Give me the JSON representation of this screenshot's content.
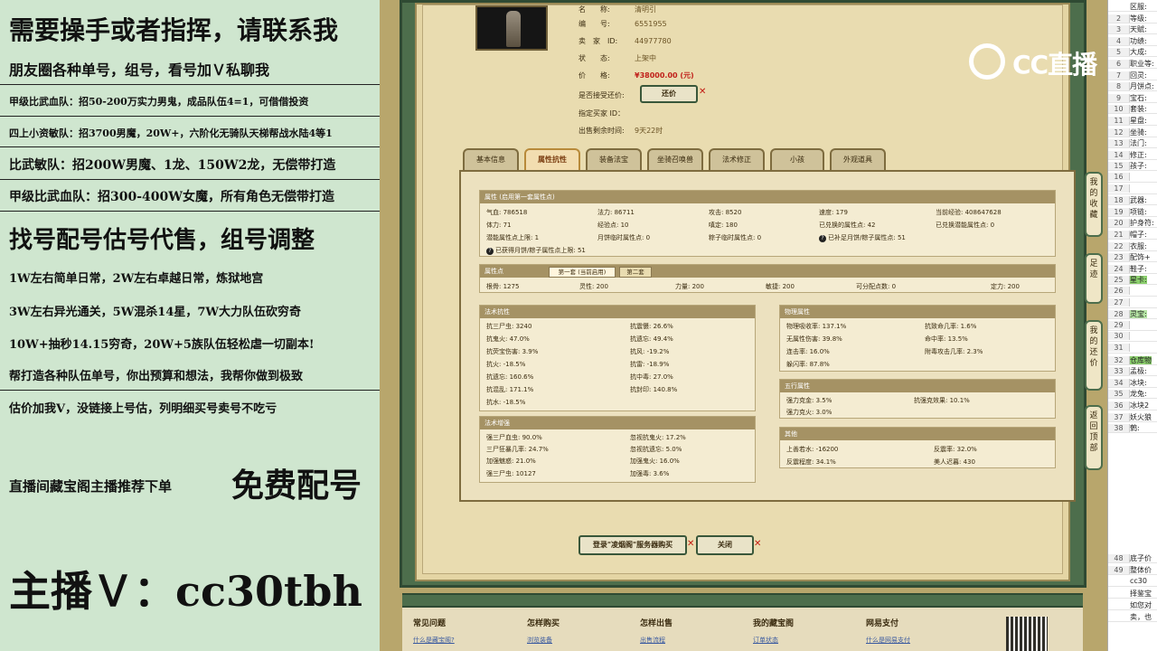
{
  "left_panel": {
    "lines": [
      "需要操手或者指挥，请联系我",
      "朋友圈各种单号，组号，看号加Ｖ私聊我",
      "甲级比武血队：招50-200万实力男鬼，成品队伍4=1，可借借投资",
      "四上小资敏队：招3700男魔，20W+，六阶化无骑队天梯帮战水陆4等1",
      "比武敏队：招200W男魔、1龙、150W2龙，无偿带打造",
      "甲级比武血队：招300-400W女魔，所有角色无偿带打造",
      "找号配号估号代售，组号调整",
      "1W左右简单日常，2W左右卓越日常，炼狱地宫",
      "3W左右异光通关，5W混杀14星，7W大力队伍砍穷奇",
      "10W+抽秒14.15穷奇，20W+5族队伍轻松虐一切副本!",
      "帮打造各种队伍单号，你出预算和想法，我帮你做到极致",
      "估价加我V，没链接上号估，列明细买号卖号不吃亏",
      "直播间藏宝阁主播推荐下单",
      "免费配号",
      "主播Ｖ：cc30tbh"
    ]
  },
  "item_info": {
    "rows": [
      {
        "k": "名　　称:",
        "v": "清明引"
      },
      {
        "k": "编　　号:",
        "v": "6551955"
      },
      {
        "k": "卖　家　ID:",
        "v": "44977780"
      },
      {
        "k": "状　　态:",
        "v": "上架中"
      },
      {
        "k": "价　　格:",
        "v": "¥38000.00 (元)"
      },
      {
        "k": "是否接受还价:",
        "v": ""
      },
      {
        "k": "指定买家 ID：",
        "v": ""
      },
      {
        "k": "出售剩余时间:",
        "v": "9天22时"
      }
    ],
    "offer_button": "还价"
  },
  "tabs": [
    "基本信息",
    "属性抗性",
    "装备法宝",
    "坐骑召唤兽",
    "法术修正",
    "小孩",
    "外观道具"
  ],
  "attr_section": {
    "header": "属性 (启用第一套属性点)",
    "cells": [
      "气血: 786518",
      "法力: 86711",
      "攻击: 8520",
      "速度: 179",
      "当前经验: 408647628",
      "体力: 71",
      "经验点: 10",
      "嗔定: 180",
      "已兑换的属性点: 42",
      "已兑换潜能属性点: 0",
      "潜能属性点上限: 1",
      "月饼临时属性点: 0",
      "粽子临时属性点: 0",
      "已补足月饼/粽子属性点: 51",
      "已获得月饼/粽子属性点上限: 51"
    ]
  },
  "attr_points": {
    "header": "属性点",
    "subtabs": [
      "第一套 (当前启用)",
      "第二套"
    ],
    "cells": [
      "根骨: 1275",
      "灵性: 200",
      "力量: 200",
      "敏捷: 200",
      "可分配点数: 0",
      "定力: 200"
    ]
  },
  "magic_resist": {
    "header": "法术抗性",
    "cells": [
      "抗三尸虫: 3240",
      "抗震慑: 26.6%",
      "抗鬼火: 47.0%",
      "抗遗忘: 49.4%",
      "抗荧宝伤害: 3.9%",
      "抗风: -19.2%",
      "抗火: -18.5%",
      "抗雷: -18.9%",
      "抗遗忘: 160.6%",
      "抗中毒: 27.0%",
      "抗混乱: 171.1%",
      "抗封印: 140.8%",
      "抗水: -18.5%"
    ]
  },
  "magic_enhance": {
    "header": "法术增强",
    "cells": [
      "强三尸血虫: 90.0%",
      "忽视抗鬼火: 17.2%",
      "三尸狂暴几率: 24.7%",
      "忽视抗遗忘: 5.0%",
      "加强魅惑: 21.0%",
      "加强鬼火: 16.0%",
      "强三尸虫: 10127",
      "加强毒: 3.6%"
    ]
  },
  "phys_attr": {
    "header": "物理属性",
    "cells": [
      "物理吸收率: 137.1%",
      "抗致命几率: 1.6%",
      "无属性伤害: 39.8%",
      "命中率: 13.5%",
      "连击率: 16.0%",
      "附毒攻击几率: 2.3%",
      "躲闪率: 87.8%"
    ]
  },
  "five_elements": {
    "header": "五行属性",
    "cells": [
      "强力克金: 3.5%",
      "抗强克效果: 10.1%",
      "强力克火: 3.0%"
    ]
  },
  "other_attr": {
    "header": "其他",
    "cells": [
      "上善若水: -16200",
      "反震率: 32.0%",
      "反震程度: 34.1%",
      "美人迟暮: 430"
    ]
  },
  "bottom_buttons": {
    "login_buy": "登录\"凌烟阁\"服务器购买",
    "close": "关闭"
  },
  "side_rail": [
    "我的收藏",
    "足迹",
    "我的还价",
    "返回顶部"
  ],
  "footer": {
    "columns": [
      {
        "title": "常见问题",
        "link": "什么是藏宝阁?"
      },
      {
        "title": "怎样购买",
        "link": "浏览装备"
      },
      {
        "title": "怎样出售",
        "link": "出售流程"
      },
      {
        "title": "我的藏宝阁",
        "link": "订单状态"
      },
      {
        "title": "网易支付",
        "link": "什么是网易支付"
      }
    ]
  },
  "watermark": {
    "text": "CC直播"
  },
  "sheet": {
    "rows": [
      {
        "n": "",
        "t": "区服:"
      },
      {
        "n": "2",
        "t": "等级:"
      },
      {
        "n": "3",
        "t": "天赋:"
      },
      {
        "n": "4",
        "t": "功绩:"
      },
      {
        "n": "5",
        "t": "大成:"
      },
      {
        "n": "6",
        "t": "职业等:"
      },
      {
        "n": "7",
        "t": "回灵:"
      },
      {
        "n": "8",
        "t": "月饼点:"
      },
      {
        "n": "9",
        "t": "宝石:"
      },
      {
        "n": "10",
        "t": "套装:"
      },
      {
        "n": "11",
        "t": "星盘:"
      },
      {
        "n": "12",
        "t": "坐骑:"
      },
      {
        "n": "13",
        "t": "法门:"
      },
      {
        "n": "14",
        "t": "修正:"
      },
      {
        "n": "15",
        "t": "孩子:"
      },
      {
        "n": "16",
        "t": ""
      },
      {
        "n": "17",
        "t": ""
      },
      {
        "n": "18",
        "t": "武器:"
      },
      {
        "n": "19",
        "t": "项链:"
      },
      {
        "n": "20",
        "t": "护身符:"
      },
      {
        "n": "21",
        "t": "帽子:"
      },
      {
        "n": "22",
        "t": "衣服:"
      },
      {
        "n": "23",
        "t": "配饰+"
      },
      {
        "n": "24",
        "t": "鞋子:"
      },
      {
        "n": "25",
        "t": "星卡:"
      },
      {
        "n": "26",
        "t": ""
      },
      {
        "n": "27",
        "t": ""
      },
      {
        "n": "28",
        "t": "灵宝:"
      },
      {
        "n": "29",
        "t": ""
      },
      {
        "n": "30",
        "t": ""
      },
      {
        "n": "31",
        "t": ""
      },
      {
        "n": "32",
        "t": "仓库物"
      },
      {
        "n": "33",
        "t": "孟极:"
      },
      {
        "n": "34",
        "t": "冰块:"
      },
      {
        "n": "35",
        "t": "龙兔:"
      },
      {
        "n": "36",
        "t": "冰块2"
      },
      {
        "n": "37",
        "t": "妖火狼"
      },
      {
        "n": "38",
        "t": "鹩:"
      }
    ],
    "bottom_rows": [
      {
        "n": "48",
        "t": "底子价"
      },
      {
        "n": "49",
        "t": "整体价"
      },
      {
        "n": "",
        "t": "cc30"
      },
      {
        "n": "",
        "t": "择鉴宝"
      },
      {
        "n": "",
        "t": "如您对"
      },
      {
        "n": "",
        "t": "卖，也"
      }
    ]
  }
}
